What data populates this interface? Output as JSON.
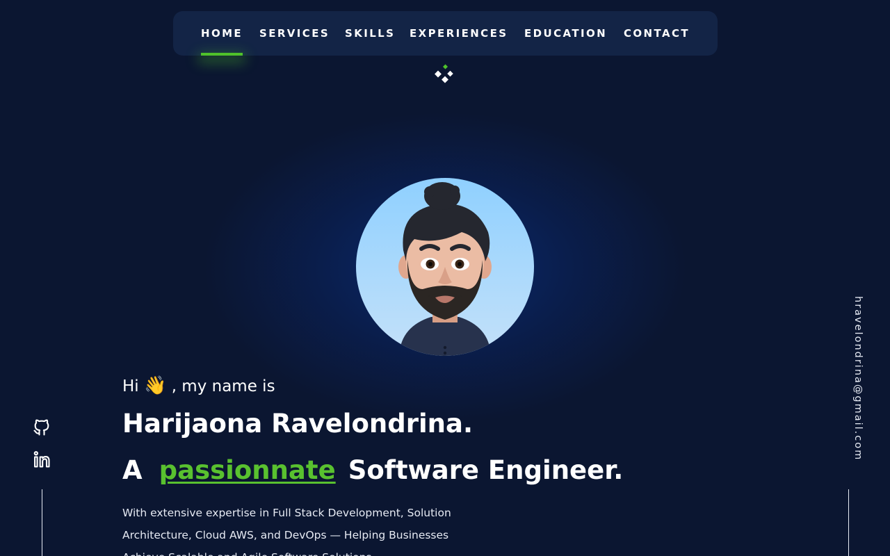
{
  "nav": {
    "items": [
      {
        "label": "HOME",
        "active": true
      },
      {
        "label": "SERVICES",
        "active": false
      },
      {
        "label": "SKILLS",
        "active": false
      },
      {
        "label": "EXPERIENCES",
        "active": false
      },
      {
        "label": "EDUCATION",
        "active": false
      },
      {
        "label": "CONTACT",
        "active": false
      }
    ]
  },
  "hero": {
    "greeting_prefix": "Hi",
    "wave_emoji": "👋",
    "greeting_suffix": ", my name is",
    "name": "Harijaona Ravelondrina.",
    "tagline_prefix": "A",
    "tagline_accent": "passionnate",
    "tagline_suffix": "Software Engineer.",
    "description": "With extensive expertise in Full Stack Development, Solution Architecture, Cloud AWS, and DevOps — Helping Businesses Achieve Scalable and Agile Software Solutions"
  },
  "sidebar": {
    "email": "hravelondrina@gmail.com",
    "social": [
      {
        "icon": "github-icon"
      },
      {
        "icon": "linkedin-icon"
      }
    ]
  },
  "colors": {
    "background": "#0b1631",
    "nav_background": "#132446",
    "accent": "#59c12f",
    "text": "#ffffff"
  }
}
